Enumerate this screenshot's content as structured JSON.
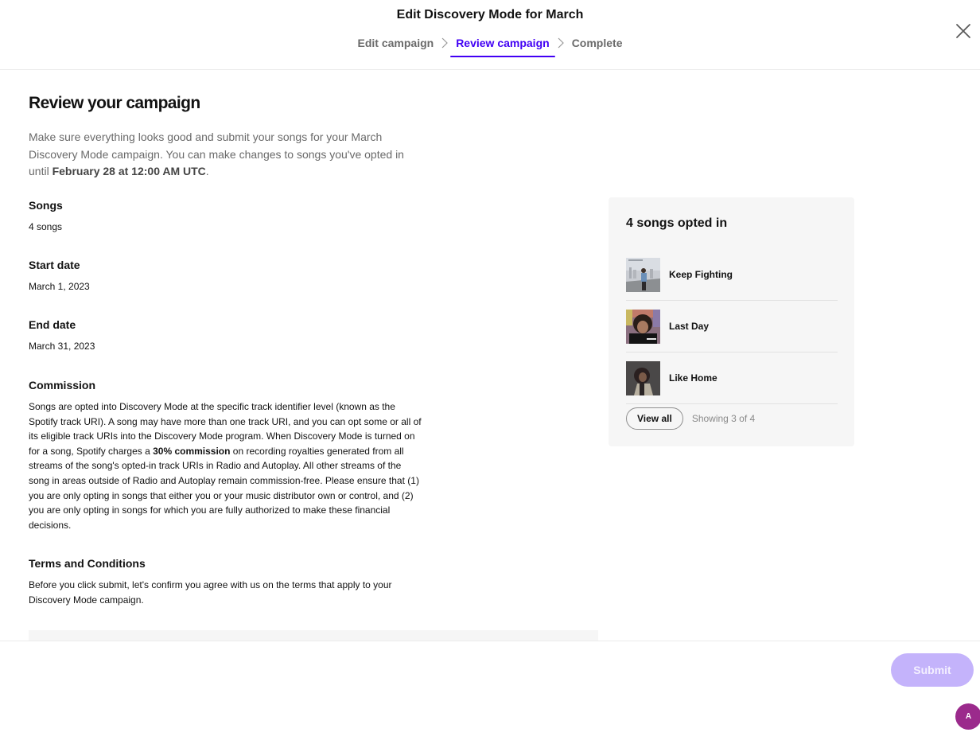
{
  "header": {
    "title": "Edit Discovery Mode for March",
    "steps": [
      {
        "label": "Edit campaign",
        "state": "done"
      },
      {
        "label": "Review campaign",
        "state": "active"
      },
      {
        "label": "Complete",
        "state": "pending"
      }
    ],
    "close_icon": "close-icon"
  },
  "main": {
    "title": "Review your campaign",
    "intro_prefix": "Make sure everything looks good and submit your songs for your March Discovery Mode campaign. You can make changes to songs you've opted in until ",
    "intro_deadline": "February 28 at 12:00 AM UTC",
    "intro_suffix": ".",
    "songs": {
      "label": "Songs",
      "value": "4 songs"
    },
    "start_date": {
      "label": "Start date",
      "value": "March 1, 2023"
    },
    "end_date": {
      "label": "End date",
      "value": "March 31, 2023"
    },
    "commission": {
      "label": "Commission",
      "text_prefix": "Songs are opted into Discovery Mode at the specific track identifier level (known as the Spotify track URI). A song may have more than one track URI, and you can opt some or all of its eligible track URIs into the Discovery Mode program. When Discovery Mode is turned on for a song, Spotify charges a ",
      "text_bold": "30% commission",
      "text_suffix": " on recording royalties generated from all streams of the song's opted-in track URIs in Radio and Autoplay. All other streams of the song in areas outside of Radio and Autoplay remain commission-free. Please ensure that (1) you are only opting in songs that either you or your music distributor own or control, and (2) you are only opting in songs for which you are fully authorized to make these financial decisions."
    },
    "terms": {
      "label": "Terms and Conditions",
      "text": "Before you click submit, let's confirm you agree with us on the terms that apply to your Discovery Mode campaign."
    }
  },
  "songs_card": {
    "title": "4 songs opted in",
    "songs": [
      {
        "name": "Keep Fighting",
        "art": "album-art-keep-fighting"
      },
      {
        "name": "Last Day",
        "art": "album-art-last-day"
      },
      {
        "name": "Like Home",
        "art": "album-art-like-home"
      }
    ],
    "view_all_label": "View all",
    "showing_text": "Showing 3 of 4"
  },
  "footer": {
    "submit_label": "Submit",
    "avatar_initial": "A"
  },
  "colors": {
    "accent": "#4100f4",
    "submit_disabled": "#c4b3fb",
    "avatar": "#9b2a8c",
    "card_bg": "#f6f6f6"
  }
}
